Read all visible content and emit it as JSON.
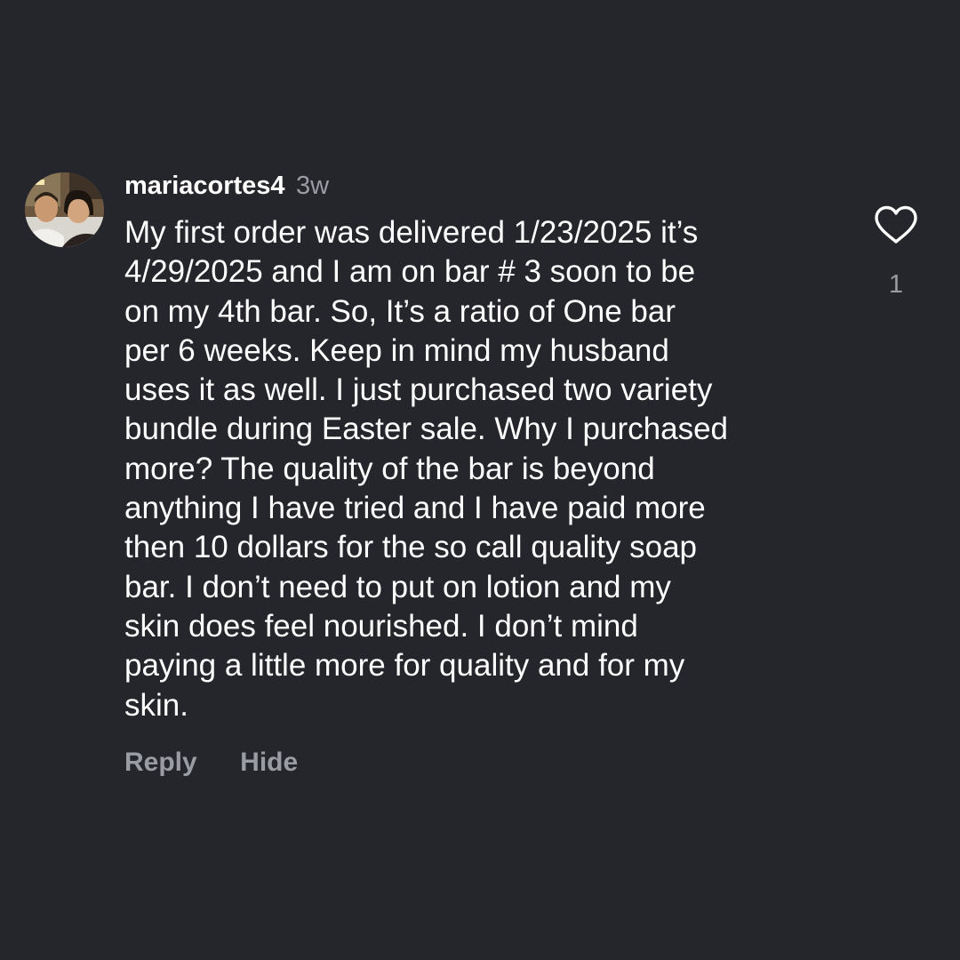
{
  "comment": {
    "username": "mariacortes4",
    "timestamp": "3w",
    "text": "My first order was delivered 1/23/2025 it’s\n4/29/2025 and I am on bar # 3 soon to be\non my 4th bar.  So, It’s a ratio of One bar\nper 6 weeks.  Keep in mind my husband\nuses it as well.  I just purchased two variety\nbundle during Easter sale.  Why I purchased\nmore? The quality of the bar is beyond\nanything I have tried and I have paid more\nthen 10 dollars for the so call quality soap\nbar.  I don’t need to put on lotion and my\nskin does feel nourished.  I don’t mind\npaying a little more for quality and for my\nskin.",
    "avatar_icon": "profile-photo",
    "like_icon": "heart-outline-icon",
    "like_count": "1",
    "actions": {
      "reply_label": "Reply",
      "hide_label": "Hide"
    }
  },
  "colors": {
    "background": "#25262c",
    "primary_text": "#ffffff",
    "secondary_text": "#9a9ca4"
  }
}
